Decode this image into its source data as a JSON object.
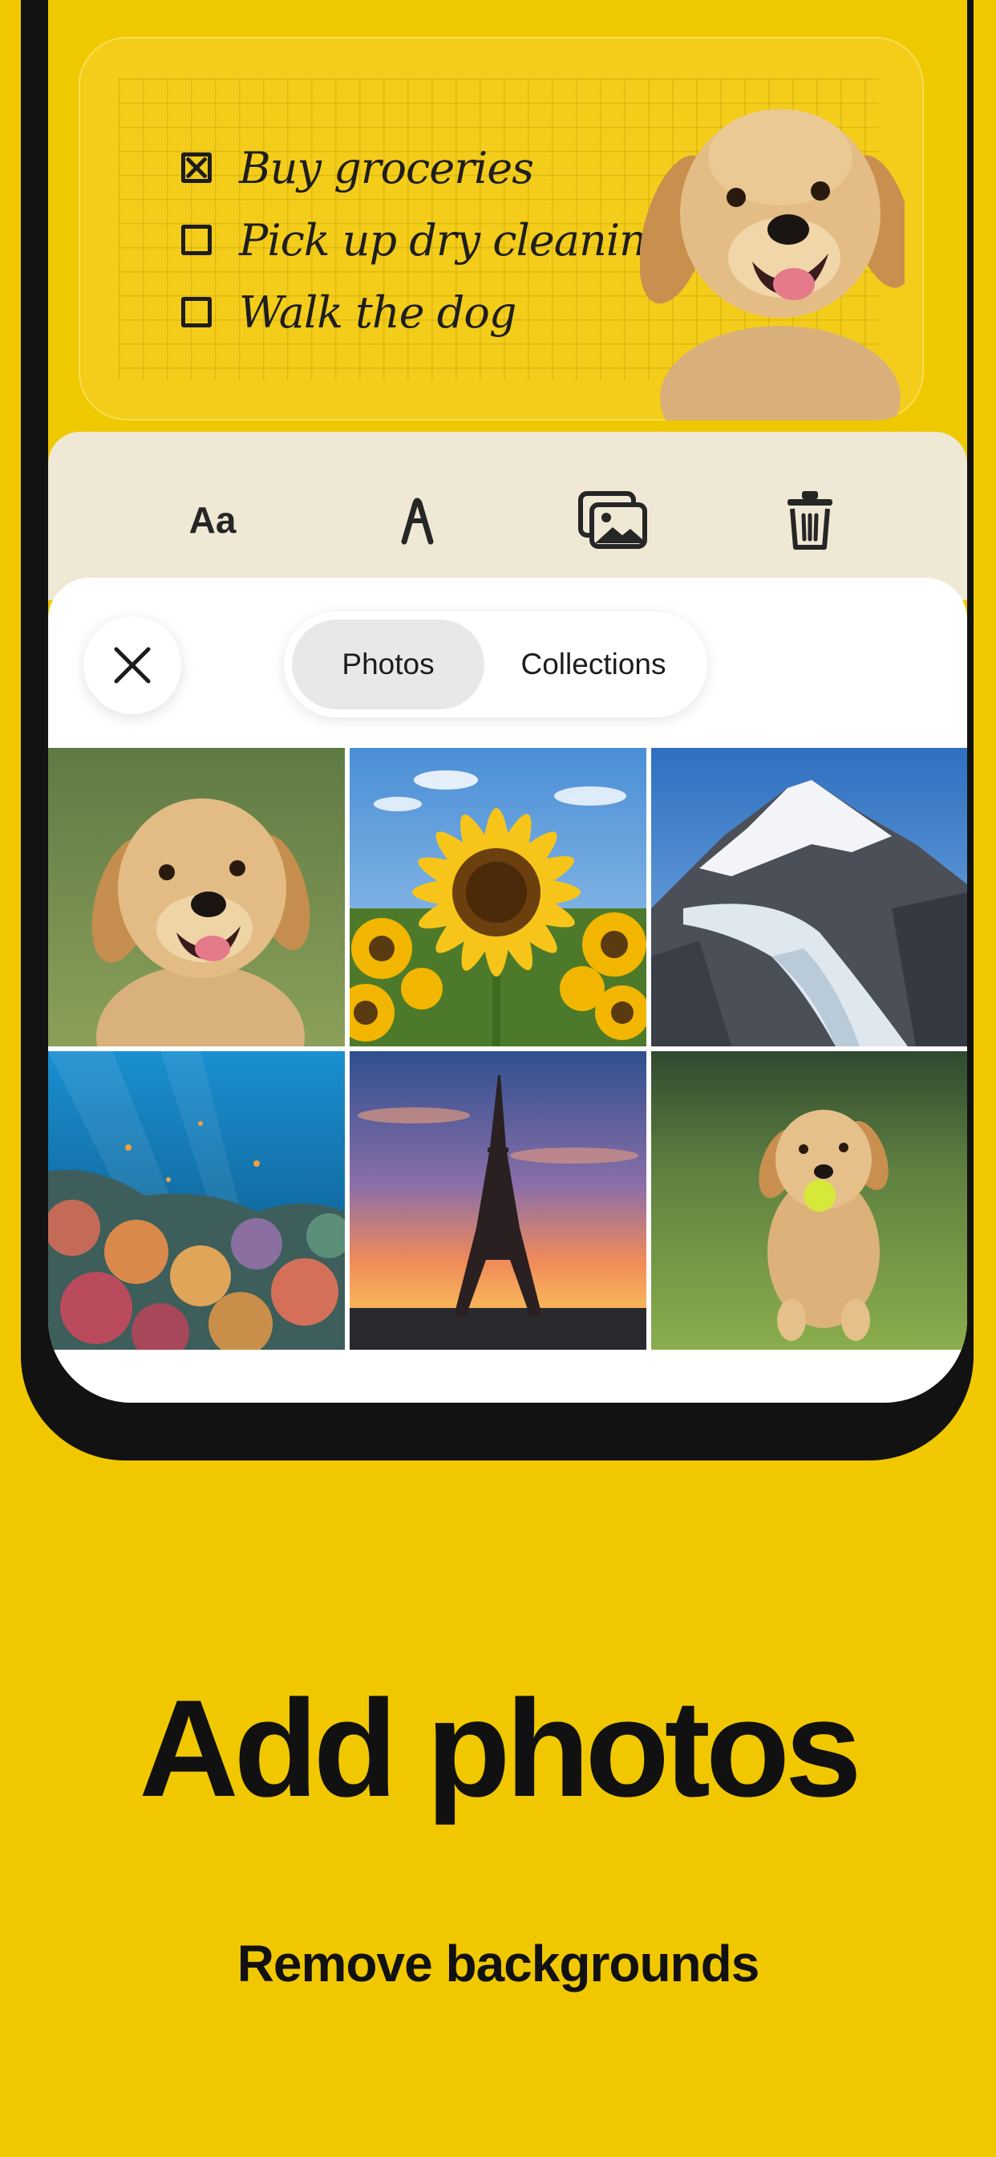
{
  "note": {
    "checklist": [
      {
        "label": "Buy groceries",
        "checked": true
      },
      {
        "label": "Pick up dry cleaning",
        "checked": false
      },
      {
        "label": "Walk the dog",
        "checked": false
      }
    ],
    "sticker": "golden-retriever-puppy-cutout"
  },
  "toolbar": {
    "text_label": "Aa",
    "icons": [
      "text-style-icon",
      "pen-icon",
      "photos-icon",
      "trash-icon"
    ]
  },
  "picker": {
    "tabs": [
      "Photos",
      "Collections"
    ],
    "active_tab": "Photos",
    "close_icon": "close-icon",
    "photos": [
      "puppy",
      "sunflowers",
      "snowy-mountain-glacier",
      "coral-reef",
      "eiffel-tower-sunset",
      "puppy-with-ball"
    ]
  },
  "caption": {
    "headline": "Add photos",
    "subheadline": "Remove backgrounds"
  },
  "colors": {
    "background": "#f1c800",
    "frame": "#121212",
    "toolbar": "#efe8d4",
    "active_tab": "#e8e8e8"
  }
}
